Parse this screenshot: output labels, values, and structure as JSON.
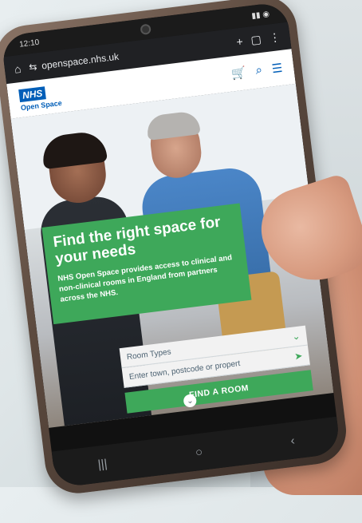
{
  "status_bar": {
    "time": "12:10"
  },
  "browser": {
    "url": "openspace.nhs.uk",
    "icons": [
      "home-icon",
      "site-settings-icon",
      "new-tab-icon",
      "tabs-icon",
      "menu-icon"
    ]
  },
  "site_header": {
    "logo_text": "NHS",
    "logo_subtitle": "Open Space",
    "icons": [
      "cart-icon",
      "search-icon",
      "hamburger-menu-icon"
    ]
  },
  "hero": {
    "title": "Find the right space for your needs",
    "description": "NHS Open Space provides access to clinical and non-clinical rooms in England from partners across the NHS."
  },
  "search": {
    "room_types_label": "Room Types",
    "location_placeholder": "Enter town, postcode or propert",
    "find_button": "FIND A ROOM"
  },
  "nav": {
    "icons": [
      "recent-apps-icon",
      "home-button-icon",
      "back-icon"
    ]
  },
  "colors": {
    "nhs_blue": "#005eb8",
    "green": "#3ea85a",
    "phone_frame": "#5c4a3f"
  }
}
